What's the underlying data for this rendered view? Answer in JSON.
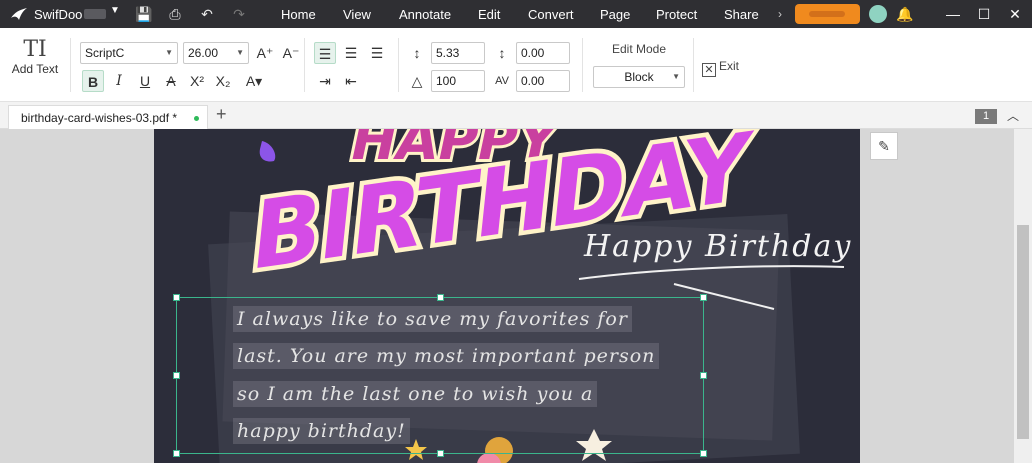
{
  "app": {
    "name": "SwifDoo"
  },
  "menu": [
    "Home",
    "View",
    "Annotate",
    "Edit",
    "Convert",
    "Page",
    "Protect",
    "Share"
  ],
  "toolbar": {
    "add_text": "Add Text",
    "font_family": "ScriptC",
    "font_size": "26.00",
    "line_spacing": "5.33",
    "char_spacing": "0.00",
    "scale": "100",
    "word_spacing": "0.00",
    "edit_mode_label": "Edit Mode",
    "edit_mode_value": "Block",
    "exit_label": "Exit"
  },
  "tabs": {
    "file_name": "birthday-card-wishes-03.pdf *"
  },
  "page_indicator": "1",
  "card": {
    "title": "BIRTHDAY",
    "subtitle": "Happy Birthday",
    "text_lines": [
      "I always like to save my favorites for",
      "last. You are my most important person",
      "so I am the last one to wish you a",
      "happy birthday!"
    ]
  },
  "colors": {
    "accent": "#3bb58c",
    "title_bar": "#2f2f33",
    "upgrade": "#f08a1e",
    "birthday_fill": "#d54ce6",
    "birthday_outline": "#fff3c8"
  }
}
